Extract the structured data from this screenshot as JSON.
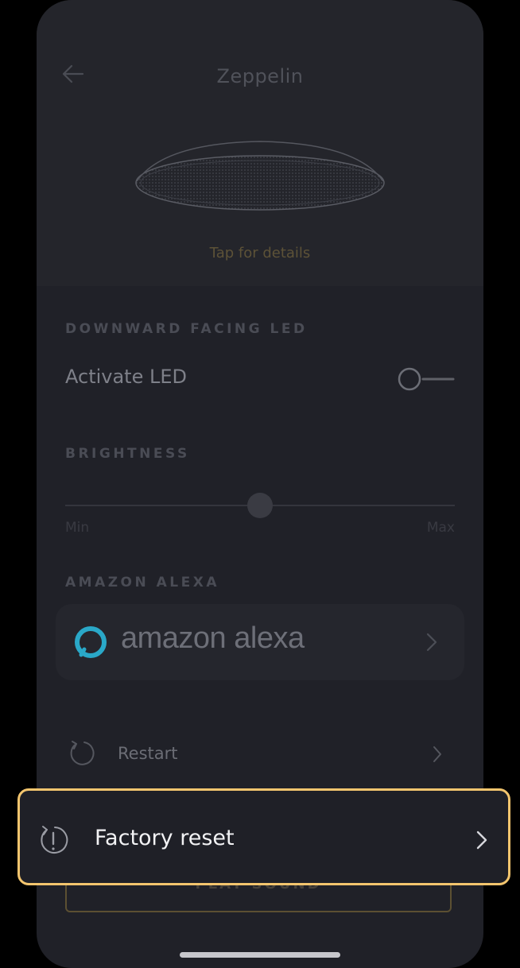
{
  "header": {
    "title": "Zeppelin",
    "tap_hint": "Tap for details"
  },
  "led_section": {
    "heading": "DOWNWARD FACING LED",
    "activate_label": "Activate LED",
    "activate_on": false
  },
  "brightness_section": {
    "heading": "BRIGHTNESS",
    "min_label": "Min",
    "max_label": "Max",
    "level_fraction": 0.5
  },
  "alexa_section": {
    "heading": "AMAZON ALEXA",
    "card_text": "amazon alexa"
  },
  "actions": {
    "restart_label": "Restart",
    "factory_reset_label": "Factory reset",
    "play_sound_label": "PLAY SOUND"
  },
  "icons": {
    "back": "back-arrow-icon",
    "restart": "restart-icon",
    "factory_reset": "factory-reset-icon",
    "chevron": "chevron-right-icon"
  },
  "colors": {
    "highlight": "#f3c56e",
    "accent_gold": "#5d5237",
    "alexa_blue": "#2aa8c8"
  }
}
